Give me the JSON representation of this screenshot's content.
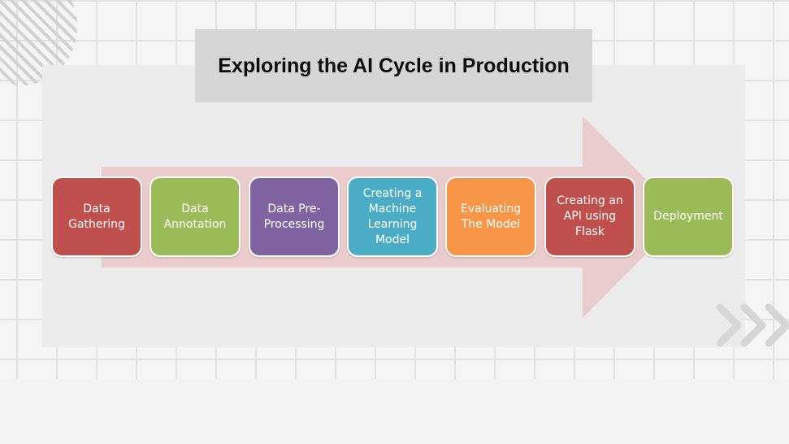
{
  "title": "Exploring the AI Cycle in Production",
  "steps": [
    {
      "label": "Data\nGathering",
      "color": "#c0504d"
    },
    {
      "label": "Data\nAnnotation",
      "color": "#9bbb59"
    },
    {
      "label": "Data Pre-\nProcessing",
      "color": "#8064a2"
    },
    {
      "label": "Creating a\nMachine\nLearning\nModel",
      "color": "#4bacc6"
    },
    {
      "label": "Evaluating\nThe Model",
      "color": "#f79646"
    },
    {
      "label": "Creating an\nAPI using\nFlask",
      "color": "#c0504d"
    },
    {
      "label": "Deployment",
      "color": "#9bbb59"
    }
  ],
  "arrow_color": "#ebcccd",
  "decorations": {
    "top_left": "diagonal-stripes-circle",
    "bottom_right": "chevron-right-icon"
  }
}
